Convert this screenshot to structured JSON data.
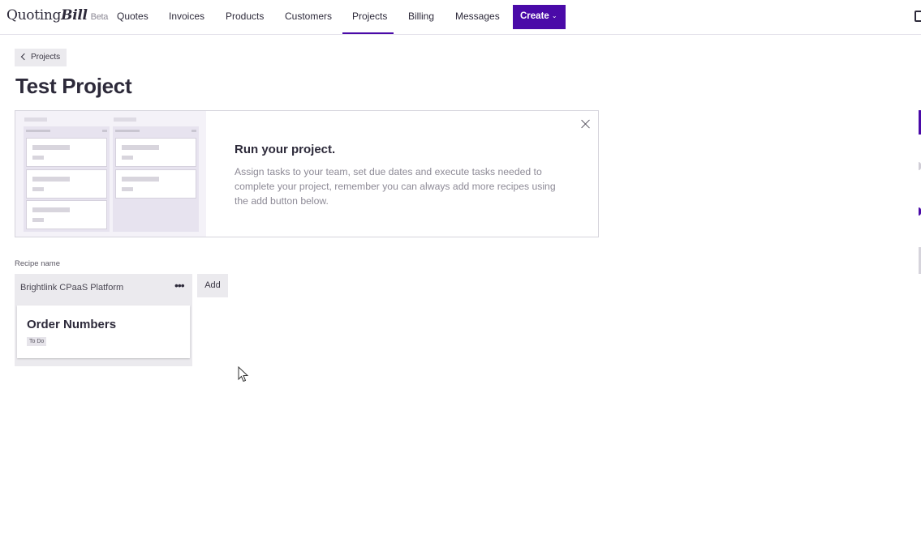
{
  "header": {
    "logo": {
      "part1": "Quoting",
      "part2": "Bill",
      "badge": "Beta"
    },
    "nav": [
      {
        "label": "Quotes"
      },
      {
        "label": "Invoices"
      },
      {
        "label": "Products"
      },
      {
        "label": "Customers"
      },
      {
        "label": "Projects",
        "active": true
      },
      {
        "label": "Billing"
      },
      {
        "label": "Messages"
      }
    ],
    "create_label": "Create",
    "accent_color": "#4a0aa8"
  },
  "breadcrumb": {
    "back_label": "Projects"
  },
  "page": {
    "title": "Test Project"
  },
  "banner": {
    "title": "Run your project.",
    "text": "Assign tasks to your team, set due dates and execute tasks needed to complete your project, remember you can always add more recipes using the add button below."
  },
  "recipe": {
    "label": "Recipe name",
    "board_title": "Brightlink CPaaS Platform",
    "more_icon": "more-horizontal-icon",
    "add_label": "Add",
    "cards": [
      {
        "title": "Order Numbers",
        "status": "To Do"
      }
    ]
  }
}
